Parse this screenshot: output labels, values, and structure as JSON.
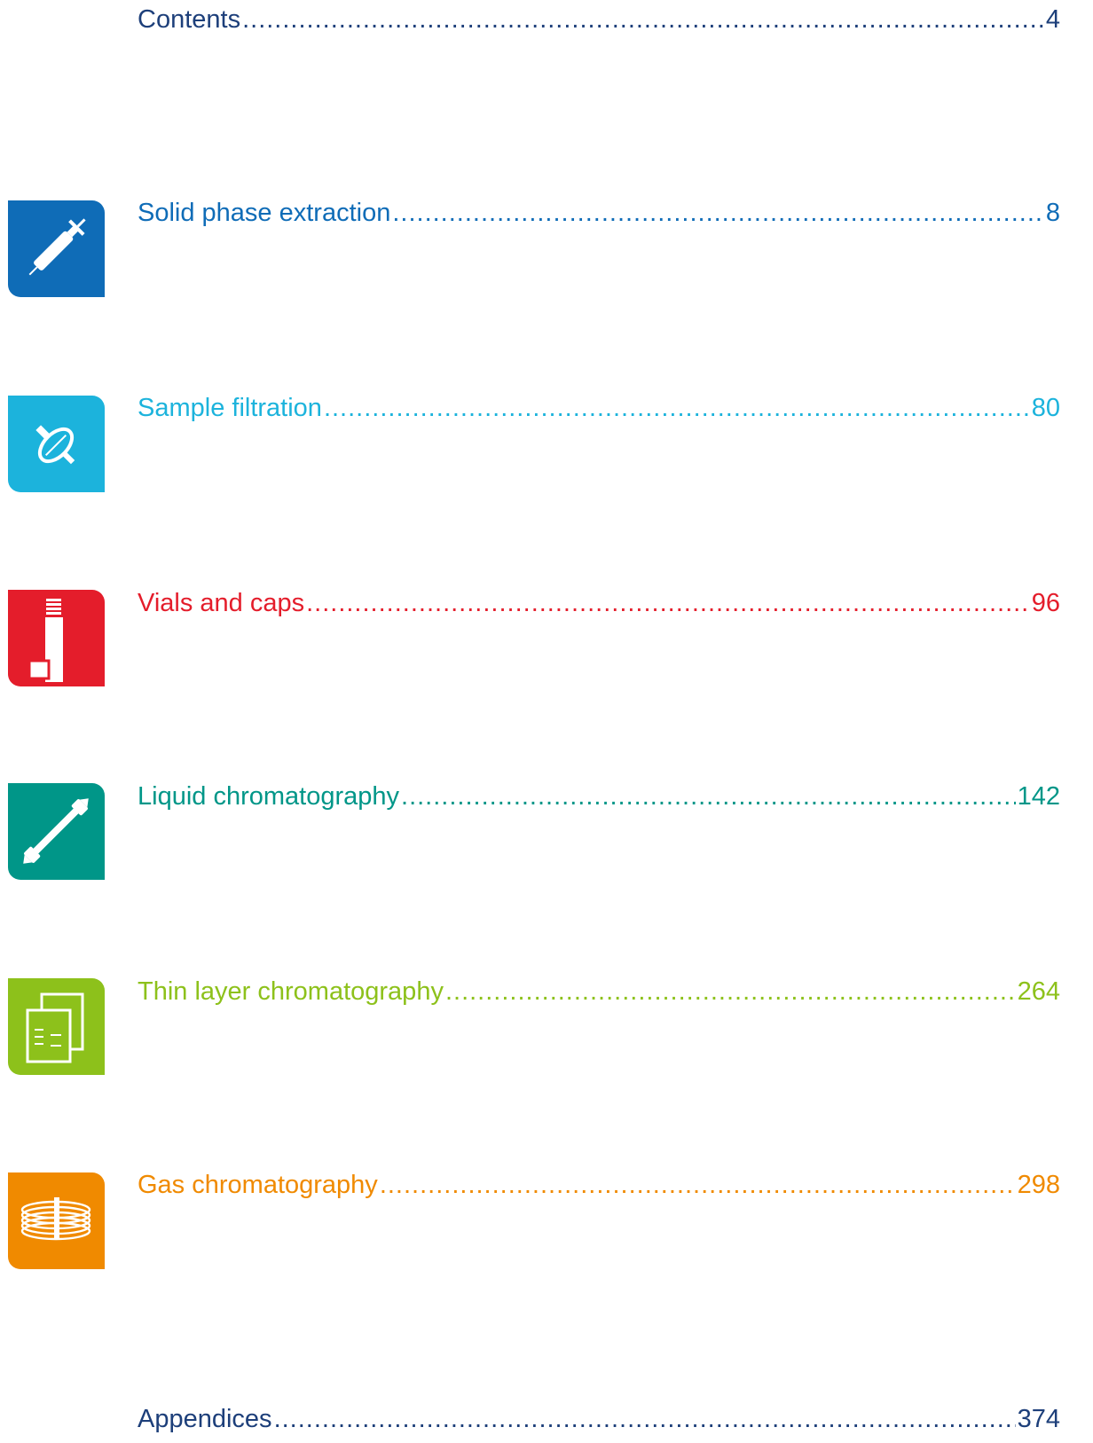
{
  "entries": [
    {
      "id": "contents",
      "title": "Contents",
      "page": "4",
      "color": "#1d3f7a",
      "icon": null
    },
    {
      "id": "spe",
      "title": "Solid phase extraction",
      "page": "8",
      "color": "#0f6cb7",
      "icon": "syringe-icon"
    },
    {
      "id": "filtration",
      "title": "Sample filtration",
      "page": "80",
      "color": "#1cb3dc",
      "icon": "syringe-filter-icon"
    },
    {
      "id": "vials",
      "title": "Vials and caps",
      "page": "96",
      "color": "#e41d2b",
      "icon": "vial-icon"
    },
    {
      "id": "lc",
      "title": "Liquid chromatography",
      "page": "142",
      "color": "#009688",
      "icon": "lc-column-icon"
    },
    {
      "id": "tlc",
      "title": "Thin layer chromatography",
      "page": "264",
      "color": "#8dc11b",
      "icon": "tlc-plate-icon"
    },
    {
      "id": "gc",
      "title": "Gas chromatography",
      "page": "298",
      "color": "#f08a00",
      "icon": "gc-column-coil-icon"
    },
    {
      "id": "appendices",
      "title": "Appendices",
      "page": "374",
      "color": "#1d3f7a",
      "icon": null
    }
  ]
}
